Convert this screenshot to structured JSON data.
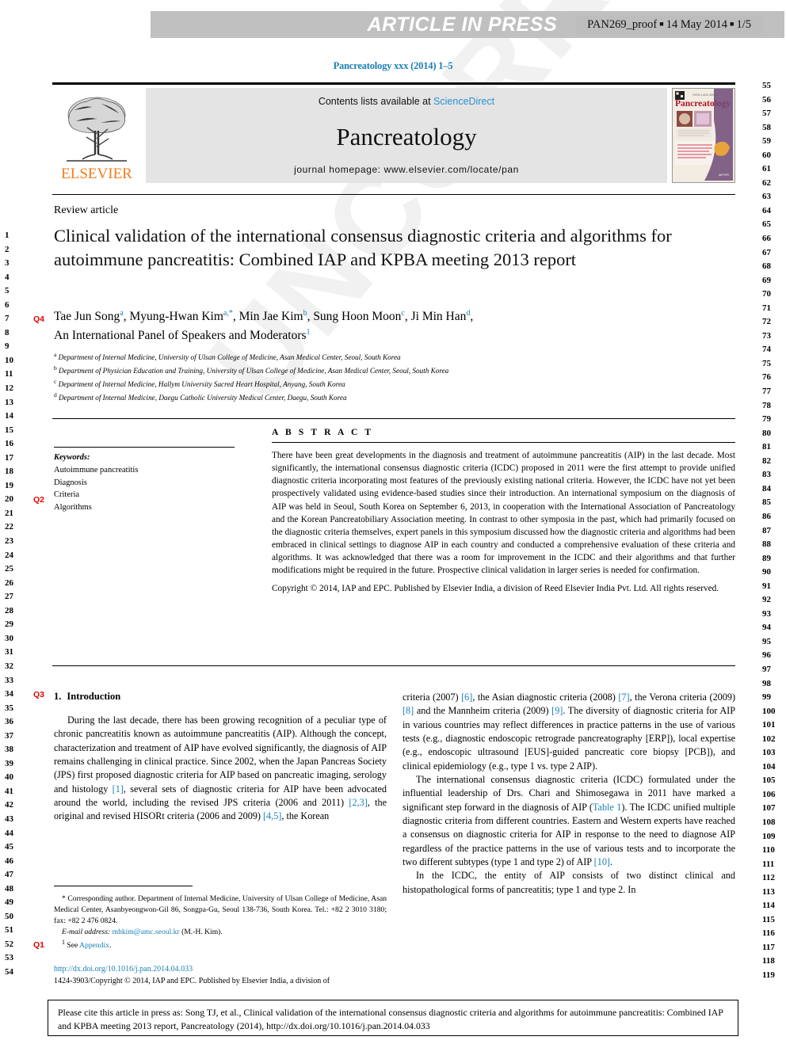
{
  "press_banner": {
    "label": "ARTICLE IN PRESS",
    "proof_id": "PAN269_proof",
    "proof_date": "14 May 2014",
    "proof_page": "1/5",
    "separator": "■"
  },
  "journal_line": "Pancreatology xxx (2014) 1–5",
  "masthead": {
    "publisher": "ELSEVIER",
    "contents_prefix": "Contents lists available at ",
    "contents_link": "ScienceDirect",
    "journal_title": "Pancreatology",
    "homepage": "journal homepage: www.elsevier.com/locate/pan",
    "cover_title": "Pancreatology"
  },
  "article": {
    "type_label": "Review article",
    "title": "Clinical validation of the international consensus diagnostic criteria and algorithms for autoimmune pancreatitis: Combined IAP and KPBA meeting 2013 report",
    "authors_line1": "Tae Jun Song a, Myung-Hwan Kim a,*, Min Jae Kim b, Sung Hoon Moon c, Ji Min Han d,",
    "authors_line2": "An International Panel of Speakers and Moderators 1",
    "affiliations": [
      "a Department of Internal Medicine, University of Ulsan College of Medicine, Asan Medical Center, Seoul, South Korea",
      "b Department of Physician Education and Training, University of Ulsan College of Medicine, Asan Medical Center, Seoul, South Korea",
      "c Department of Internal Medicine, Hallym University Sacred Heart Hospital, Anyang, South Korea",
      "d Department of Internal Medicine, Daegu Catholic University Medical Center, Daegu, South Korea"
    ]
  },
  "keywords": {
    "heading": "Keywords:",
    "items": [
      "Autoimmune pancreatitis",
      "Diagnosis",
      "Criteria",
      "Algorithms"
    ]
  },
  "abstract": {
    "heading": "A B S T R A C T",
    "body": "There have been great developments in the diagnosis and treatment of autoimmune pancreatitis (AIP) in the last decade. Most significantly, the international consensus diagnostic criteria (ICDC) proposed in 2011 were the first attempt to provide unified diagnostic criteria incorporating most features of the previously existing national criteria. However, the ICDC have not yet been prospectively validated using evidence-based studies since their introduction. An international symposium on the diagnosis of AIP was held in Seoul, South Korea on September 6, 2013, in cooperation with the International Association of Pancreatology and the Korean Pancreatobiliary Association meeting. In contrast to other symposia in the past, which had primarily focused on the diagnostic criteria themselves, expert panels in this symposium discussed how the diagnostic criteria and algorithms had been embraced in clinical settings to diagnose AIP in each country and conducted a comprehensive evaluation of these criteria and algorithms. It was acknowledged that there was a room for improvement in the ICDC and their algorithms and that further modifications might be required in the future. Prospective clinical validation in larger series is needed for confirmation.",
    "copyright": "Copyright © 2014, IAP and EPC. Published by Elsevier India, a division of Reed Elsevier India Pvt. Ltd. All rights reserved."
  },
  "body": {
    "section_number": "1.",
    "section_title": "Introduction",
    "left_paragraph_1": "During the last decade, there has been growing recognition of a peculiar type of chronic pancreatitis known as autoimmune pancreatitis (AIP). Although the concept, characterization and treatment of AIP have evolved significantly, the diagnosis of AIP remains challenging in clinical practice. Since 2002, when the Japan Pancreas Society (JPS) first proposed diagnostic criteria for AIP based on pancreatic imaging, serology and histology [1], several sets of diagnostic criteria for AIP have been advocated around the world, including the revised JPS criteria (2006 and 2011) [2,3], the original and revised HISORt criteria (2006 and 2009) [4,5], the Korean",
    "right_paragraph_1": "criteria (2007) [6], the Asian diagnostic criteria (2008) [7], the Verona criteria (2009) [8] and the Mannheim criteria (2009) [9]. The diversity of diagnostic criteria for AIP in various countries may reflect differences in practice patterns in the use of various tests (e.g., diagnostic endoscopic retrograde pancreatography [ERP]), local expertise (e.g., endoscopic ultrasound [EUS]-guided pancreatic core biopsy [PCB]), and clinical epidemiology (e.g., type 1 vs. type 2 AIP).",
    "right_paragraph_2": "The international consensus diagnostic criteria (ICDC) formulated under the influential leadership of Drs. Chari and Shimosegawa in 2011 have marked a significant step forward in the diagnosis of AIP (Table 1). The ICDC unified multiple diagnostic criteria from different countries. Eastern and Western experts have reached a consensus on diagnostic criteria for AIP in response to the need to diagnose AIP regardless of the practice patterns in the use of various tests and to incorporate the two different subtypes (type 1 and type 2) of AIP [10].",
    "right_paragraph_3": "In the ICDC, the entity of AIP consists of two distinct clinical and histopathological forms of pancreatitis; type 1 and type 2. In"
  },
  "footnotes": {
    "corresponding": "* Corresponding author. Department of Internal Medicine, University of Ulsan College of Medicine, Asan Medical Center, Asanbyeongwon-Gil 86, Songpa-Gu, Seoul 138-736, South Korea. Tel.: +82 2 3010 3180; fax: +82 2 476 0824.",
    "email_label": "E-mail address:",
    "email": "mhkim@amc.seoul.kr",
    "email_suffix": "(M.-H. Kim).",
    "appendix_marker": "1",
    "appendix_prefix": "See ",
    "appendix_link": "Appendix",
    "appendix_suffix": "."
  },
  "doi": {
    "url": "http://dx.doi.org/10.1016/j.pan.2014.04.033",
    "issn_line": "1424-3903/Copyright © 2014, IAP and EPC. Published by Elsevier India, a division of"
  },
  "citation_footer": "Please cite this article in press as: Song TJ, et al., Clinical validation of the international consensus diagnostic criteria and algorithms for autoimmune pancreatitis: Combined IAP and KPBA meeting 2013 report, Pancreatology (2014), http://dx.doi.org/10.1016/j.pan.2014.04.033",
  "line_numbers": {
    "left_start": 1,
    "left_end": 54,
    "right_start": 55,
    "right_end": 119
  },
  "query_markers": [
    {
      "label": "Q4",
      "line": 7
    },
    {
      "label": "Q2",
      "line": 20
    },
    {
      "label": "Q3",
      "line": 34
    },
    {
      "label": "Q1",
      "line": 52
    }
  ],
  "watermark_text": "UNCORRECTED PROOF",
  "colors": {
    "link": "#1a7fb5",
    "elsevier_orange": "#ef7d1a",
    "query_red": "#e60000",
    "banner_gray": "#c0c0c0"
  }
}
